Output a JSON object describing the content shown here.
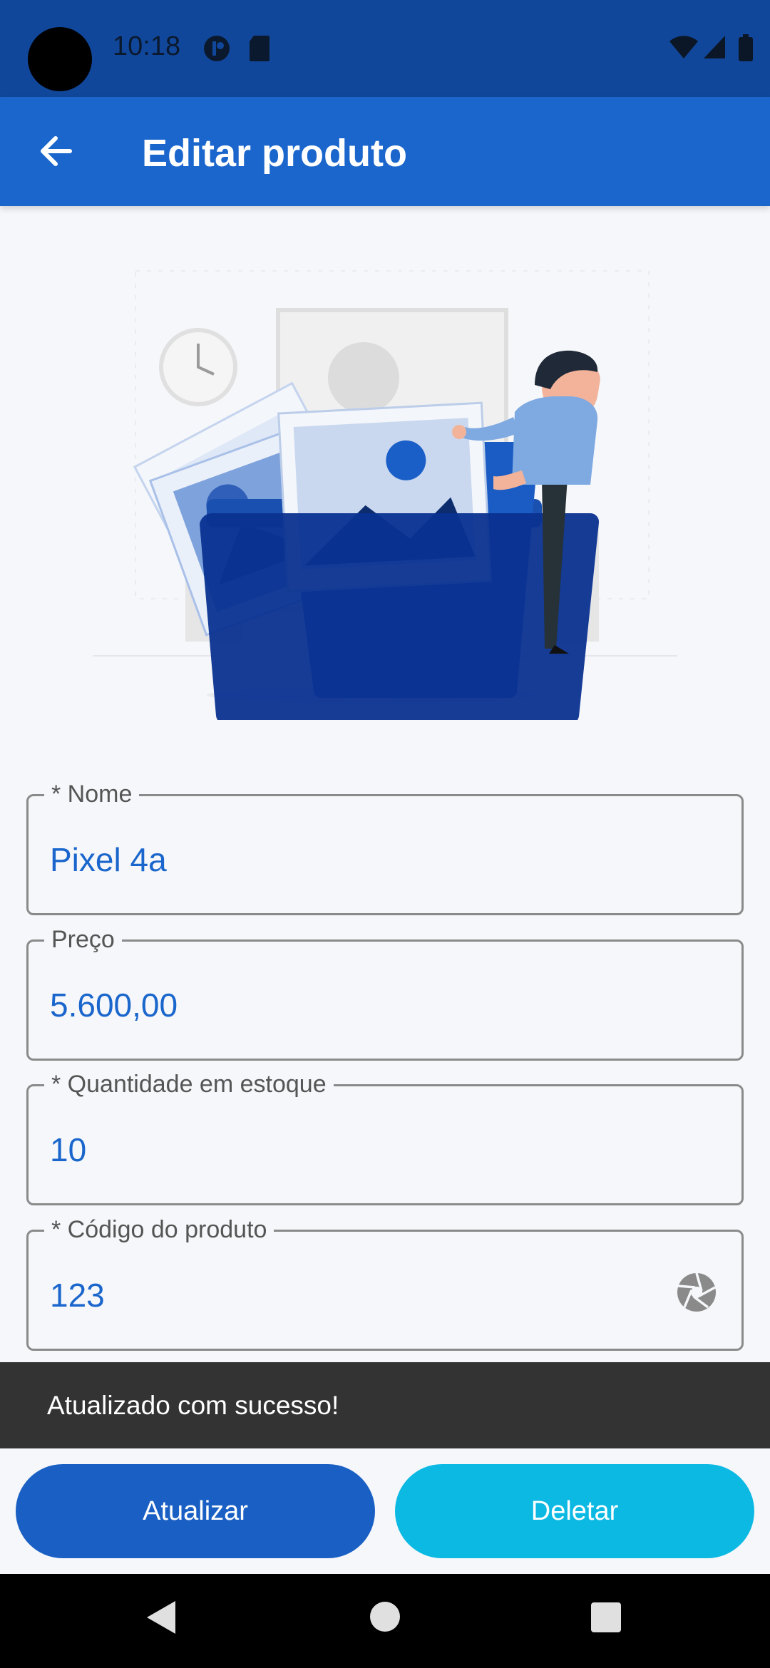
{
  "status_bar": {
    "time": "10:18"
  },
  "app_bar": {
    "title": "Editar produto"
  },
  "form": {
    "name": {
      "label": "* Nome",
      "value": "Pixel 4a"
    },
    "price": {
      "label": "Preço",
      "value": "5.600,00"
    },
    "stock": {
      "label": "* Quantidade em estoque",
      "value": "10"
    },
    "code": {
      "label": "* Código do produto",
      "value": "123"
    }
  },
  "snackbar": {
    "message": "Atualizado com sucesso!"
  },
  "actions": {
    "update_label": "Atualizar",
    "delete_label": "Deletar"
  },
  "colors": {
    "primary": "#1a66cc",
    "accent": "#0bb9e3",
    "status_bar": "#11479a",
    "snackbar": "#333333"
  },
  "icons": [
    "back-arrow-icon",
    "camera-shutter-icon",
    "wifi-icon",
    "signal-icon",
    "battery-icon",
    "nav-back-icon",
    "nav-home-icon",
    "nav-recents-icon"
  ]
}
